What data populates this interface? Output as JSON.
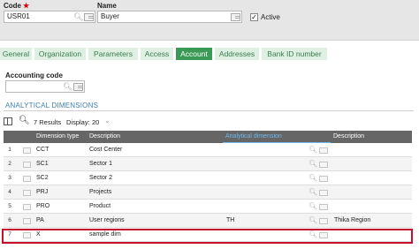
{
  "header": {
    "code_label": "Code",
    "required_mark": "★",
    "code_value": "USR01",
    "name_label": "Name",
    "name_value": "Buyer",
    "active_label": "Active",
    "active_checked": true
  },
  "tabs": [
    {
      "label": "General",
      "active": false
    },
    {
      "label": "Organization",
      "active": false
    },
    {
      "label": "Parameters",
      "active": false
    },
    {
      "label": "Access",
      "active": false
    },
    {
      "label": "Account",
      "active": true
    },
    {
      "label": "Addresses",
      "active": false
    },
    {
      "label": "Bank ID number",
      "active": false
    }
  ],
  "account": {
    "accounting_code_label": "Accounting code",
    "accounting_code_value": ""
  },
  "section_title": "ANALYTICAL DIMENSIONS",
  "toolbar": {
    "results_text": "7 Results",
    "display_label": "Display:",
    "display_value": "20"
  },
  "table": {
    "columns": [
      "Dimension type",
      "Description",
      "Analytical dimension",
      "Description"
    ],
    "rows": [
      {
        "num": "1",
        "type": "CCT",
        "desc": "Cost Center",
        "dim": "",
        "dim_desc": ""
      },
      {
        "num": "2",
        "type": "SC1",
        "desc": "Sector 1",
        "dim": "",
        "dim_desc": ""
      },
      {
        "num": "3",
        "type": "SC2",
        "desc": "Sector 2",
        "dim": "",
        "dim_desc": ""
      },
      {
        "num": "4",
        "type": "PRJ",
        "desc": "Projects",
        "dim": "",
        "dim_desc": ""
      },
      {
        "num": "5",
        "type": "PRO",
        "desc": "Product",
        "dim": "",
        "dim_desc": ""
      },
      {
        "num": "6",
        "type": "PA",
        "desc": "User regions",
        "dim": "TH",
        "dim_desc": "Thika Region"
      },
      {
        "num": "7",
        "type": "X",
        "desc": "sample dim",
        "dim": "",
        "dim_desc": ""
      }
    ]
  },
  "colors": {
    "tab_active": "#3a9a55",
    "tab_inactive": "#dff0e3",
    "header_row": "#666666",
    "accent_blue": "#3f7fb4",
    "highlight_red": "#c8102e"
  },
  "icons": [
    "search-icon",
    "list-icon",
    "grid-icon",
    "chevron-down-icon",
    "checkbox-icon"
  ]
}
